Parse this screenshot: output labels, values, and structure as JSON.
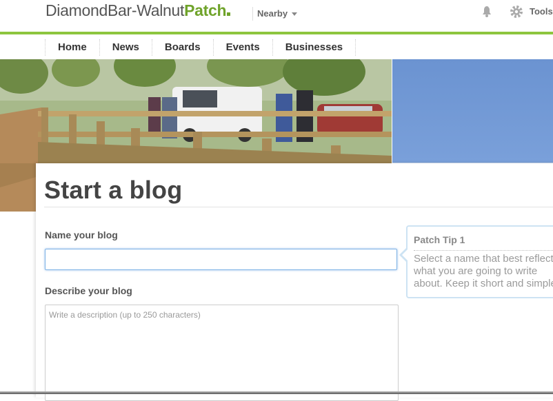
{
  "header": {
    "brand_name": "DiamondBar-Walnut",
    "brand_patch": "Patch",
    "nearby_label": "Nearby",
    "tools_label": "Tools"
  },
  "nav": {
    "items": [
      "Home",
      "News",
      "Boards",
      "Events",
      "Businesses"
    ]
  },
  "main": {
    "title": "Start a blog",
    "name_label": "Name your blog",
    "name_value": "",
    "describe_label": "Describe your blog",
    "describe_placeholder": "Write a description (up to 250 characters)"
  },
  "tip": {
    "title": "Patch Tip 1",
    "body": "Select a name that best reflects what you are going to write about. Keep it short and simple!"
  },
  "colors": {
    "accent_green": "#8dc63f",
    "brand_green": "#6fa32a",
    "focus_blue": "#7fb3e6",
    "tip_border": "#cde3f3"
  },
  "icons": {
    "notifications": "bell-icon",
    "settings": "gear-icon",
    "dropdown": "chevron-down-icon"
  }
}
